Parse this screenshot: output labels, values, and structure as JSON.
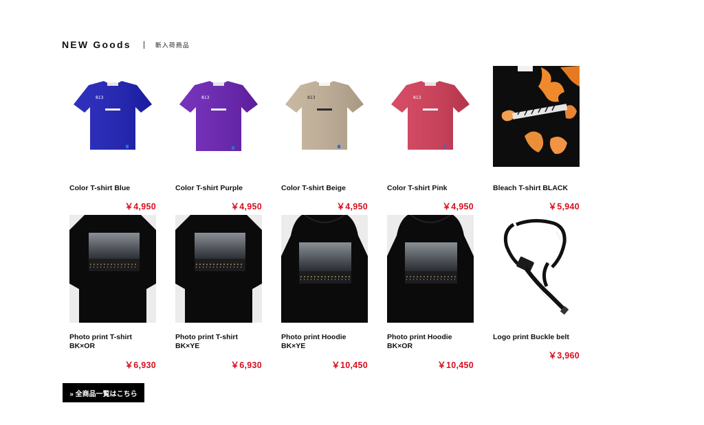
{
  "section": {
    "title": "NEW Goods",
    "subtitle": "新入荷商品"
  },
  "products": [
    {
      "name_line1": "Color T-shirt Blue",
      "name_line2": "",
      "price": "￥4,950",
      "image": "tshirt-blue",
      "color": "#1d1fb8"
    },
    {
      "name_line1": "Color T-shirt Purple",
      "name_line2": "",
      "price": "￥4,950",
      "image": "tshirt-purple",
      "color": "#6a21b5"
    },
    {
      "name_line1": "Color T-shirt Beige",
      "name_line2": "",
      "price": "￥4,950",
      "image": "tshirt-beige",
      "color": "#c4b29a"
    },
    {
      "name_line1": "Color T-shirt Pink",
      "name_line2": "",
      "price": "￥4,950",
      "image": "tshirt-pink",
      "color": "#d33d58"
    },
    {
      "name_line1": "Bleach T-shirt BLACK",
      "name_line2": "",
      "price": "￥5,940",
      "image": "bleach-tshirt",
      "color": "#0d0d0d"
    },
    {
      "name_line1": "Photo print T-shirt",
      "name_line2": "BK×OR",
      "price": "￥6,930",
      "image": "photo-print-tshirt",
      "color": "#0a0a0a"
    },
    {
      "name_line1": "Photo print T-shirt",
      "name_line2": "BK×YE",
      "price": "￥6,930",
      "image": "photo-print-tshirt",
      "color": "#0a0a0a"
    },
    {
      "name_line1": "Photo print Hoodie",
      "name_line2": "BK×YE",
      "price": "￥10,450",
      "image": "photo-print-hoodie",
      "color": "#0a0a0a"
    },
    {
      "name_line1": "Photo print Hoodie",
      "name_line2": "BK×OR",
      "price": "￥10,450",
      "image": "photo-print-hoodie",
      "color": "#0a0a0a"
    },
    {
      "name_line1": "Logo print Buckle belt",
      "name_line2": "",
      "price": "￥3,960",
      "image": "buckle-belt",
      "color": "#111111"
    }
  ],
  "all_products_button": "» 全商品一覧はこちら",
  "colors": {
    "price": "#d60f20",
    "button_bg": "#000000"
  }
}
